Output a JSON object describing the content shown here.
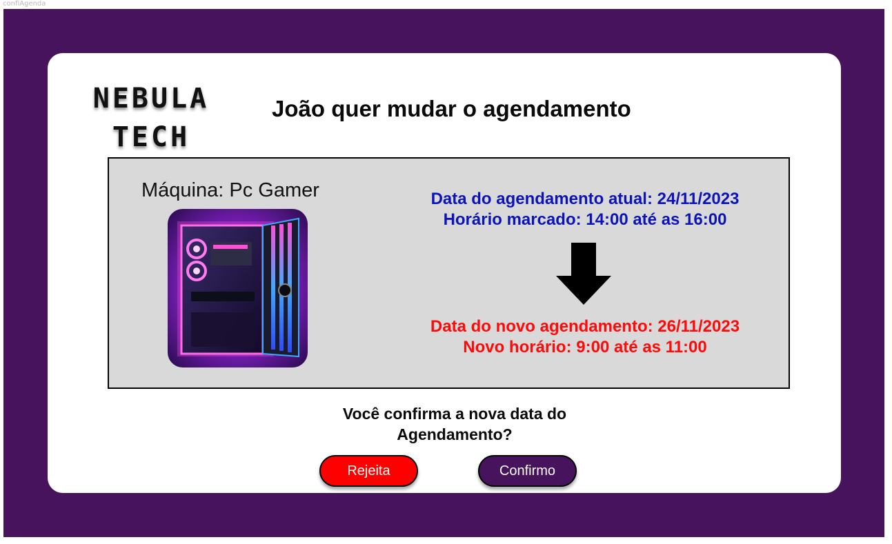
{
  "frame_label": "confiAgenda",
  "logo": {
    "line1": "NEBULA",
    "line2": "TECH"
  },
  "title": "João quer mudar o agendamento",
  "machine": {
    "label": "Máquina: Pc Gamer"
  },
  "current": {
    "date_line": "Data do agendamento atual: 24/11/2023",
    "time_line": "Horário marcado: 14:00 até as 16:00",
    "color": "#0c14b8"
  },
  "new": {
    "date_line": "Data do novo agendamento: 26/11/2023",
    "time_line": "Novo horário: 9:00 até as 11:00",
    "color": "#ff0a0a"
  },
  "question": {
    "line1": "Você confirma a nova data do",
    "line2": "Agendamento?"
  },
  "buttons": {
    "reject_label": "Rejeita",
    "confirm_label": "Confirmo"
  },
  "colors": {
    "frame": "#48135d",
    "reject": "#ff0000",
    "confirm": "#48135d"
  }
}
